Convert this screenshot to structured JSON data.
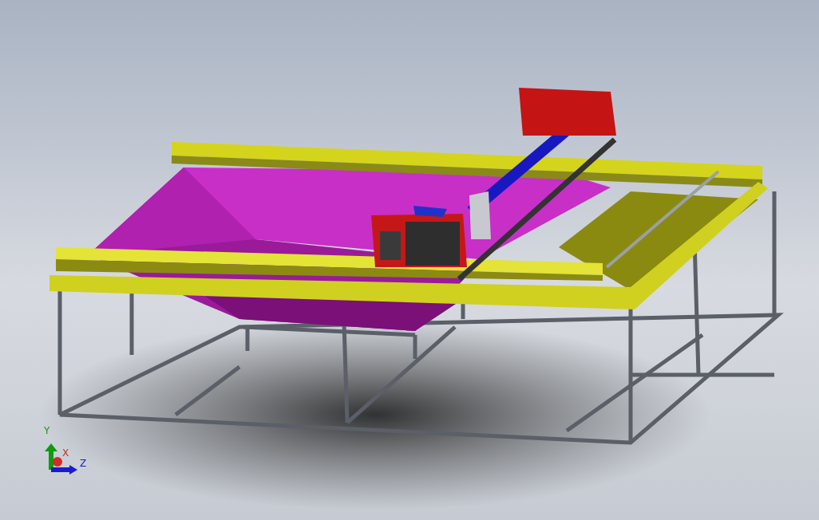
{
  "viewport": {
    "triad": {
      "axes": [
        {
          "label": "Y",
          "color": "#109a10"
        },
        {
          "label": "X",
          "color": "#d42a2a"
        },
        {
          "label": "Z",
          "color": "#1a1ad0"
        }
      ]
    }
  }
}
